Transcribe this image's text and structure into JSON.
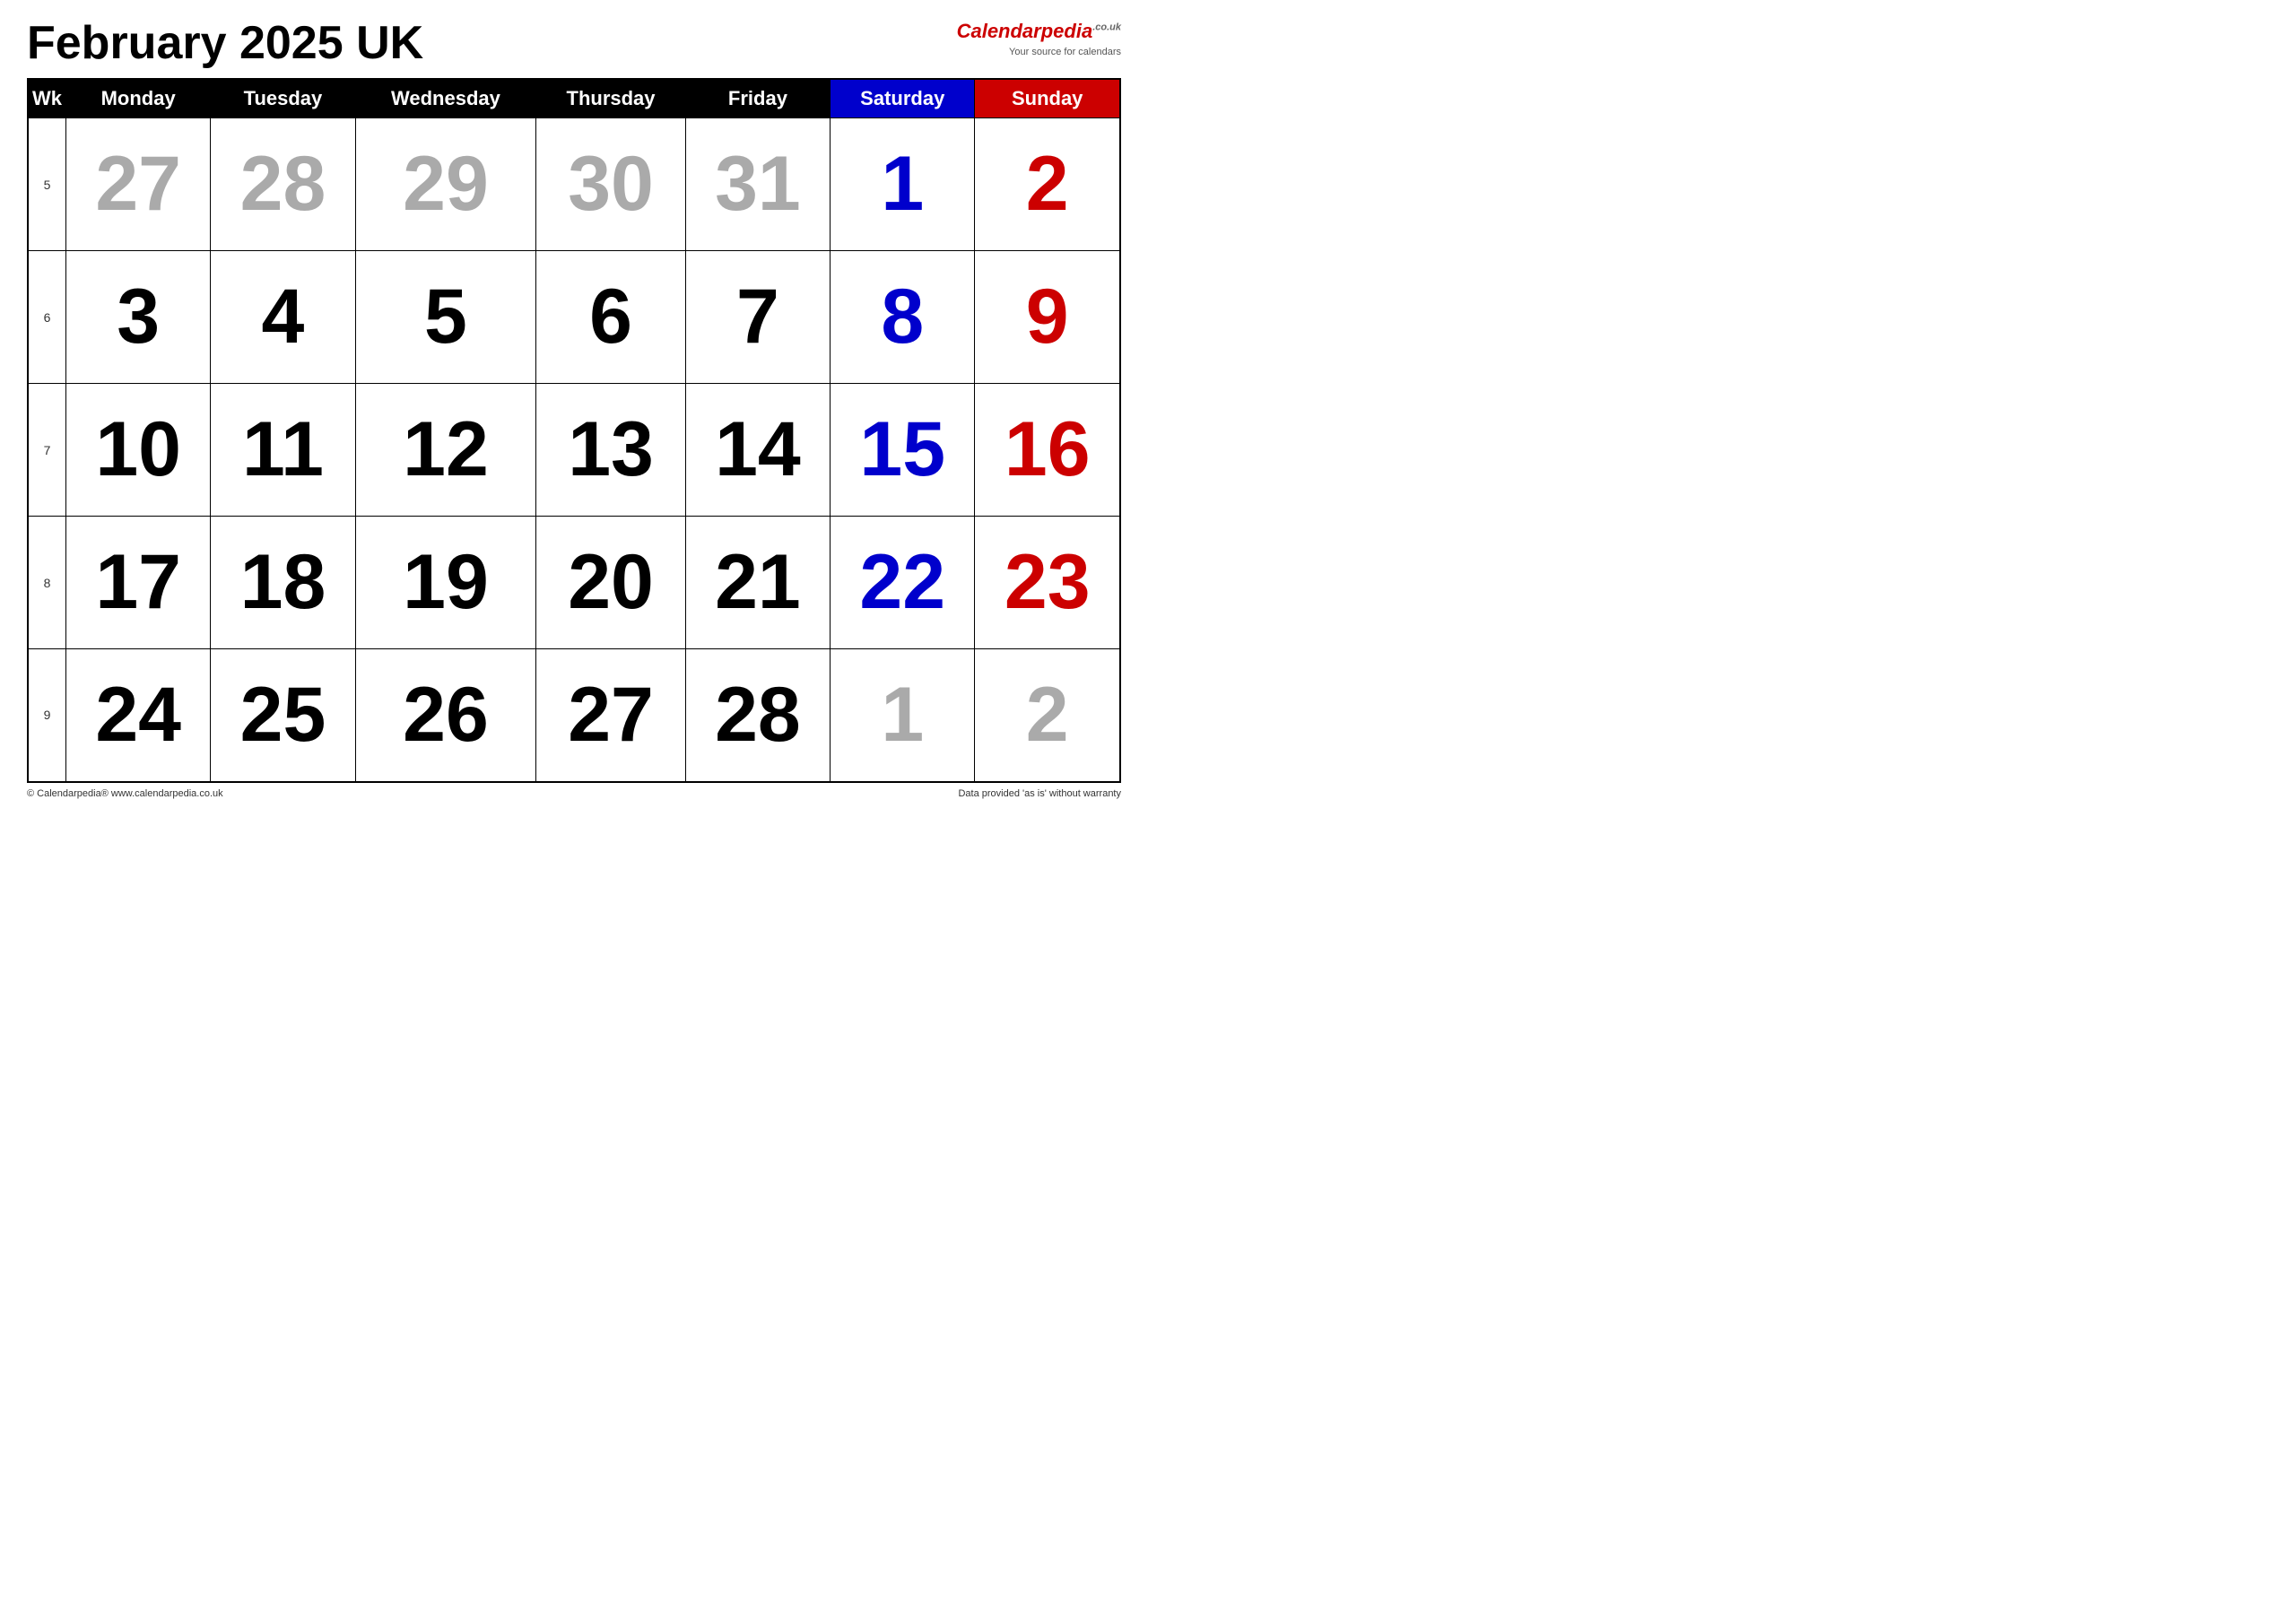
{
  "header": {
    "title": "February 2025 UK"
  },
  "logo": {
    "brand_prefix": "Calendar",
    "brand_suffix": "pedia",
    "tld": ".co.uk",
    "tagline": "Your source for calendars"
  },
  "columns": {
    "wk_label": "Wk",
    "days": [
      "Monday",
      "Tuesday",
      "Wednesday",
      "Thursday",
      "Friday",
      "Saturday",
      "Sunday"
    ]
  },
  "weeks": [
    {
      "wk": "5",
      "days": [
        {
          "num": "27",
          "type": "prev"
        },
        {
          "num": "28",
          "type": "prev"
        },
        {
          "num": "29",
          "type": "prev"
        },
        {
          "num": "30",
          "type": "prev"
        },
        {
          "num": "31",
          "type": "prev"
        },
        {
          "num": "1",
          "type": "saturday"
        },
        {
          "num": "2",
          "type": "sunday"
        }
      ]
    },
    {
      "wk": "6",
      "days": [
        {
          "num": "3",
          "type": "current"
        },
        {
          "num": "4",
          "type": "current"
        },
        {
          "num": "5",
          "type": "current"
        },
        {
          "num": "6",
          "type": "current"
        },
        {
          "num": "7",
          "type": "current"
        },
        {
          "num": "8",
          "type": "saturday"
        },
        {
          "num": "9",
          "type": "sunday"
        }
      ]
    },
    {
      "wk": "7",
      "days": [
        {
          "num": "10",
          "type": "current"
        },
        {
          "num": "11",
          "type": "current"
        },
        {
          "num": "12",
          "type": "current"
        },
        {
          "num": "13",
          "type": "current"
        },
        {
          "num": "14",
          "type": "current"
        },
        {
          "num": "15",
          "type": "saturday"
        },
        {
          "num": "16",
          "type": "sunday"
        }
      ]
    },
    {
      "wk": "8",
      "days": [
        {
          "num": "17",
          "type": "current"
        },
        {
          "num": "18",
          "type": "current"
        },
        {
          "num": "19",
          "type": "current"
        },
        {
          "num": "20",
          "type": "current"
        },
        {
          "num": "21",
          "type": "current"
        },
        {
          "num": "22",
          "type": "saturday"
        },
        {
          "num": "23",
          "type": "sunday"
        }
      ]
    },
    {
      "wk": "9",
      "days": [
        {
          "num": "24",
          "type": "current"
        },
        {
          "num": "25",
          "type": "current"
        },
        {
          "num": "26",
          "type": "current"
        },
        {
          "num": "27",
          "type": "current"
        },
        {
          "num": "28",
          "type": "current"
        },
        {
          "num": "1",
          "type": "next"
        },
        {
          "num": "2",
          "type": "next"
        }
      ]
    }
  ],
  "footer": {
    "left": "© Calendarpedia®  www.calendarpedia.co.uk",
    "right": "Data provided 'as is' without warranty"
  }
}
